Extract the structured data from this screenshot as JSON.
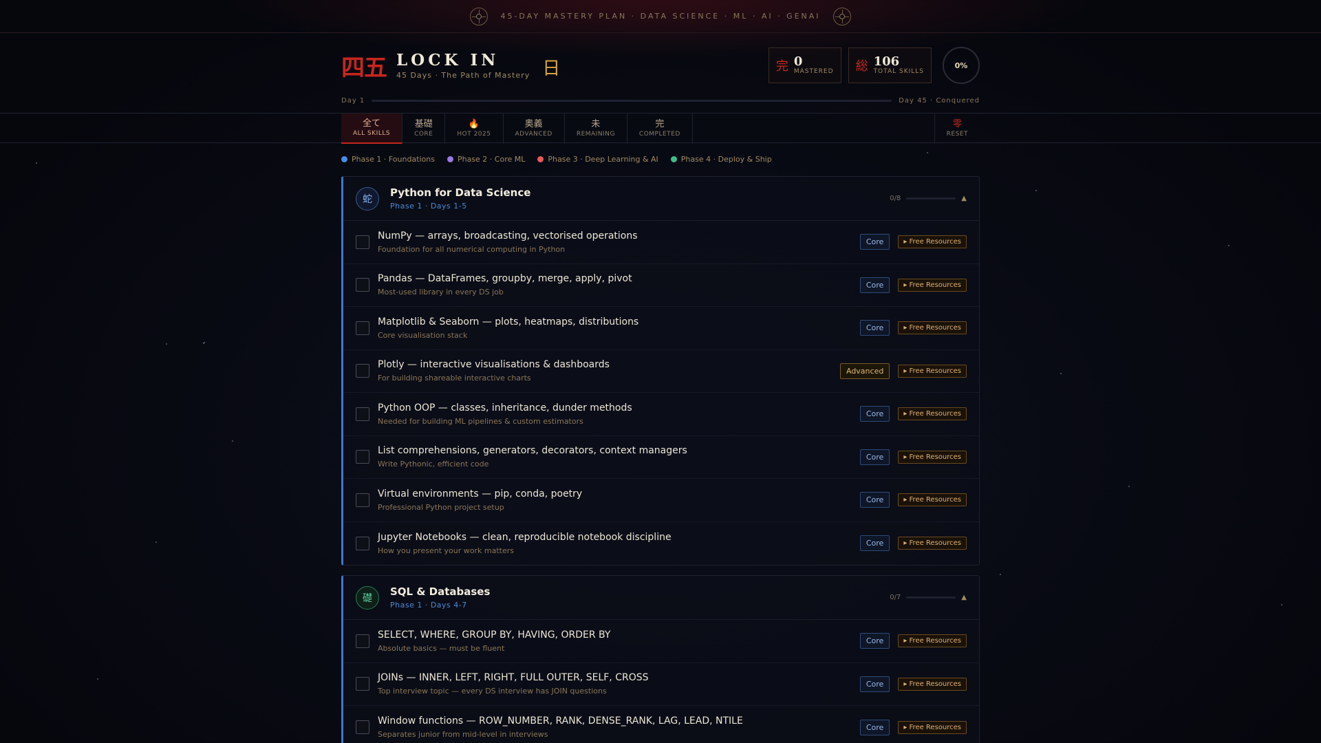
{
  "banner": {
    "text": "45-DAY MASTERY PLAN · DATA SCIENCE · ML · AI · GENAI"
  },
  "header": {
    "logo_kanji": "四五",
    "title": "LOCK IN",
    "subtitle": "45 Days · The Path of Mastery",
    "day_kanji": "日"
  },
  "stats": {
    "mastered": {
      "kanji": "完",
      "value": "0",
      "label": "MASTERED"
    },
    "total": {
      "kanji": "総",
      "value": "106",
      "label": "TOTAL SKILLS"
    },
    "percent": "0%"
  },
  "progress": {
    "start_label": "Day 1",
    "end_label": "Day 45 · Conquered",
    "fraction": 0
  },
  "tabs": [
    {
      "kanji": "全て",
      "label": "ALL SKILLS",
      "active": true
    },
    {
      "kanji": "基礎",
      "label": "CORE"
    },
    {
      "kanji": "🔥",
      "label": "HOT 2025"
    },
    {
      "kanji": "奥義",
      "label": "ADVANCED"
    },
    {
      "kanji": "未",
      "label": "REMAINING"
    },
    {
      "kanji": "完",
      "label": "COMPLETED"
    }
  ],
  "reset_tab": {
    "kanji": "零",
    "label": "RESET"
  },
  "legend": [
    {
      "label": "Phase 1 · Foundations",
      "color": "#4a8ae8"
    },
    {
      "label": "Phase 2 · Core ML",
      "color": "#9a7ae8"
    },
    {
      "label": "Phase 3 · Deep Learning & AI",
      "color": "#e85a5a"
    },
    {
      "label": "Phase 4 · Deploy & Ship",
      "color": "#3ac08a"
    }
  ],
  "sections": [
    {
      "icon": "蛇",
      "title": "Python for Data Science",
      "subtitle": "Phase 1 · Days 1-5",
      "count": "0/8",
      "items": [
        {
          "title": "NumPy — arrays, broadcasting, vectorised operations",
          "desc": "Foundation for all numerical computing in Python",
          "tag": "Core"
        },
        {
          "title": "Pandas — DataFrames, groupby, merge, apply, pivot",
          "desc": "Most-used library in every DS job",
          "tag": "Core"
        },
        {
          "title": "Matplotlib & Seaborn — plots, heatmaps, distributions",
          "desc": "Core visualisation stack",
          "tag": "Core"
        },
        {
          "title": "Plotly — interactive visualisations & dashboards",
          "desc": "For building shareable interactive charts",
          "tag": "Advanced"
        },
        {
          "title": "Python OOP — classes, inheritance, dunder methods",
          "desc": "Needed for building ML pipelines & custom estimators",
          "tag": "Core"
        },
        {
          "title": "List comprehensions, generators, decorators, context managers",
          "desc": "Write Pythonic, efficient code",
          "tag": "Core"
        },
        {
          "title": "Virtual environments — pip, conda, poetry",
          "desc": "Professional Python project setup",
          "tag": "Core"
        },
        {
          "title": "Jupyter Notebooks — clean, reproducible notebook discipline",
          "desc": "How you present your work matters",
          "tag": "Core"
        }
      ]
    },
    {
      "icon": "礎",
      "title": "SQL & Databases",
      "subtitle": "Phase 1 · Days 4-7",
      "count": "0/7",
      "items": [
        {
          "title": "SELECT, WHERE, GROUP BY, HAVING, ORDER BY",
          "desc": "Absolute basics — must be fluent",
          "tag": "Core"
        },
        {
          "title": "JOINs — INNER, LEFT, RIGHT, FULL OUTER, SELF, CROSS",
          "desc": "Top interview topic — every DS interview has JOIN questions",
          "tag": "Core"
        },
        {
          "title": "Window functions — ROW_NUMBER, RANK, DENSE_RANK, LAG, LEAD, NTILE",
          "desc": "Separates junior from mid-level in interviews",
          "tag": "Core"
        }
      ]
    }
  ],
  "resources_label": "▸ Free Resources"
}
